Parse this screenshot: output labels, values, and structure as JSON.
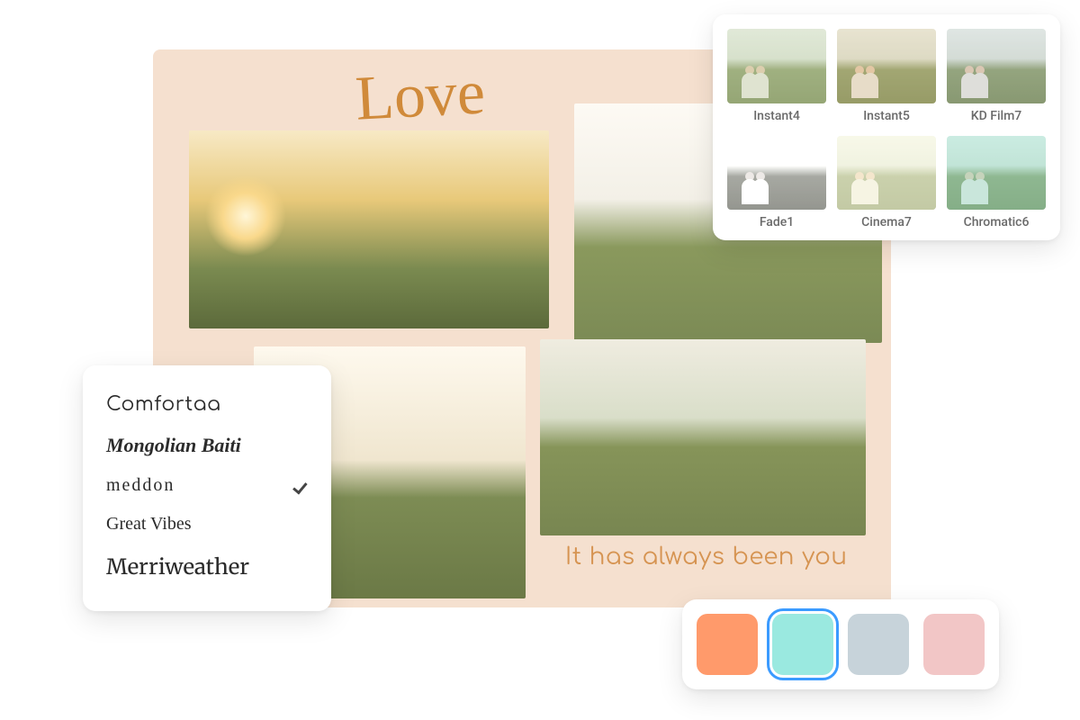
{
  "canvas": {
    "title": "Love",
    "caption": "It has always been you"
  },
  "font_picker": {
    "items": [
      {
        "label": "Comfortaa",
        "selected": false
      },
      {
        "label": "Mongolian Baiti",
        "selected": false
      },
      {
        "label": "meddon",
        "selected": true
      },
      {
        "label": "Great Vibes",
        "selected": false
      },
      {
        "label": "Merriweather",
        "selected": false
      }
    ]
  },
  "filters": {
    "items": [
      {
        "label": "Instant4",
        "class": "f-instant4"
      },
      {
        "label": "Instant5",
        "class": "f-instant5"
      },
      {
        "label": "KD Film7",
        "class": "f-kdfilm7"
      },
      {
        "label": "Fade1",
        "class": "f-fade1"
      },
      {
        "label": "Cinema7",
        "class": "f-cinema7"
      },
      {
        "label": "Chromatic6",
        "class": "f-chromatic6"
      }
    ]
  },
  "swatches": {
    "items": [
      {
        "color": "#ff9a6b",
        "selected": false
      },
      {
        "color": "#9ae9e0",
        "selected": true
      },
      {
        "color": "#c7d3da",
        "selected": false
      },
      {
        "color": "#f2c6c6",
        "selected": false
      }
    ]
  }
}
